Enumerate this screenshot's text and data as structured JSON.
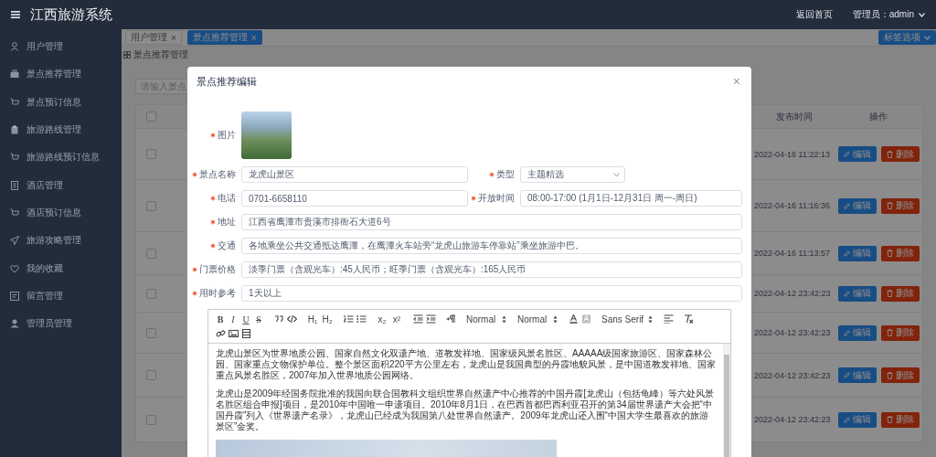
{
  "header": {
    "title": "江西旅游系统",
    "home_link": "返回首页",
    "user": "管理员：admin"
  },
  "sidebar": {
    "items": [
      {
        "label": "用户管理"
      },
      {
        "label": "景点推荐管理"
      },
      {
        "label": "景点预订信息"
      },
      {
        "label": "旅游路线管理"
      },
      {
        "label": "旅游路线预订信息"
      },
      {
        "label": "酒店管理"
      },
      {
        "label": "酒店预订信息"
      },
      {
        "label": "旅游攻略管理"
      },
      {
        "label": "我的收藏"
      },
      {
        "label": "留言管理"
      },
      {
        "label": "管理员管理"
      }
    ]
  },
  "tabs": [
    {
      "label": "用户管理",
      "close": "×",
      "selected": false
    },
    {
      "label": "景点推荐管理",
      "close": "×",
      "selected": true
    }
  ],
  "tab_menu": "标签选项",
  "breadcrumb": "景点推荐管理",
  "search": {
    "placeholder": "请输入景点"
  },
  "table": {
    "all_checked": false,
    "columns": [
      "发布时间",
      "操作"
    ],
    "rows": [
      {
        "checked": false,
        "published": "2022-04-16 11:22:13",
        "actions": [
          "编辑",
          "删除"
        ]
      },
      {
        "checked": false,
        "published": "2022-04-16 11:16:36",
        "actions": [
          "编辑",
          "删除"
        ]
      },
      {
        "checked": false,
        "published": "2022-04-16 11:13:57",
        "actions": [
          "编辑",
          "删除"
        ]
      },
      {
        "checked": false,
        "published": "2022-04-12 23:42:23",
        "actions": [
          "编辑",
          "删除"
        ]
      },
      {
        "checked": false,
        "published": "2022-04-12 23:42:23",
        "actions": [
          "编辑",
          "删除"
        ]
      },
      {
        "checked": false,
        "published": "2022-04-12 23:42:23",
        "actions": [
          "编辑",
          "删除"
        ]
      },
      {
        "checked": false,
        "published": "2022-04-12 23:42:23",
        "actions": [
          "编辑",
          "删除"
        ]
      }
    ]
  },
  "dialog": {
    "title": "景点推荐编辑",
    "close": "×",
    "rows": [
      [
        {
          "kind": "image",
          "label": "图片",
          "required": true
        }
      ],
      [
        {
          "kind": "text",
          "label": "景点名称",
          "value": "龙虎山景区",
          "required": true
        },
        {
          "kind": "select",
          "label": "类型",
          "value": "主题精选",
          "required": true
        }
      ],
      [
        {
          "kind": "text",
          "label": "电话",
          "value": "0701-6658110",
          "required": true
        },
        {
          "kind": "text",
          "label": "开放时间",
          "value": "08:00-17:00 (1月1日-12月31日 周一-周日)",
          "required": true
        }
      ],
      [
        {
          "kind": "text",
          "label": "地址",
          "value": "江西省鹰潭市贵溪市排衙石大道6号",
          "required": true
        }
      ],
      [
        {
          "kind": "text",
          "label": "交通",
          "value": "各地乘坐公共交通抵达鹰潭，在鹰潭火车站旁“龙虎山旅游车停靠站”乘坐旅游中巴。",
          "required": true
        }
      ],
      [
        {
          "kind": "text",
          "label": "门票价格",
          "value": "淡季门票（含观光车）:45人民币；旺季门票（含观光车）:165人民币",
          "required": true
        }
      ],
      [
        {
          "kind": "text",
          "label": "用时参考",
          "value": "1天以上",
          "required": true
        }
      ]
    ],
    "editor": {
      "marks": [
        "B",
        "I",
        "U",
        "S"
      ],
      "headings": [
        "H₁",
        "H₂"
      ],
      "scripts": [
        "x₂",
        "x²"
      ],
      "pickers": [
        "Normal",
        "Normal"
      ],
      "font": "Sans Serif",
      "paragraphs": [
        "龙虎山景区为世界地质公园、国家自然文化双遗产地、道教发祥地、国家级风景名胜区、AAAAA级国家旅游区、国家森林公园、国家重点文物保护单位。整个景区面积220平方公里左右，龙虎山是我国典型的丹霞地貌风景，是中国道教发祥地、国家重点风景名胜区，2007年加入世界地质公园网络。",
        "龙虎山是2009年经国务院批准的我国向联合国教科文组织世界自然遗产中心推荐的中国丹霞[龙虎山（包括龟峰）等六处风景名胜区组合申报]项目，是2010年中国唯一申遗项目。2010年8月1日，在巴西首都巴西利亚召开的第34届世界遗产大会把“中国丹霞”列入《世界遗产名录》，龙虎山已经成为我国第八处世界自然遗产。2009年龙虎山还入围“中国大学生最喜欢的旅游景区”金奖。"
      ]
    }
  }
}
